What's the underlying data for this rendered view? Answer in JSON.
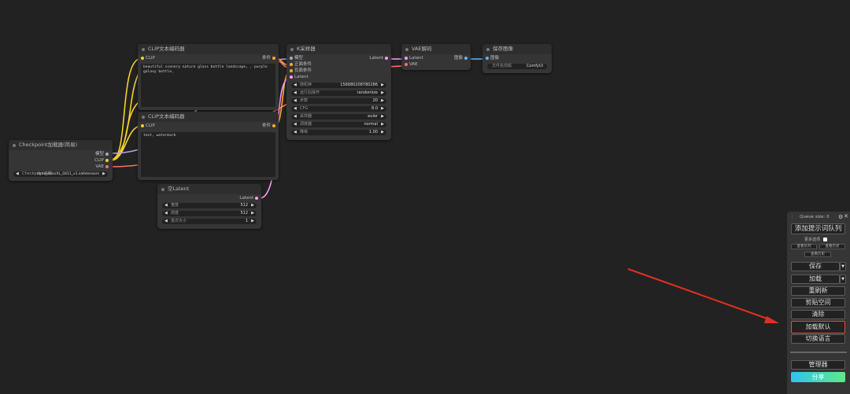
{
  "nodes": {
    "checkpoint": {
      "title": "Checkpoint加载器(简易)",
      "outputs": [
        "模型",
        "CLIP",
        "VAE"
      ],
      "ckpt_label": "Checkpoint名称",
      "ckpt_value": "dynavisionXL_0411_v1.safetensors"
    },
    "clip_pos": {
      "title": "CLIP文本编码器",
      "input": "CLIP",
      "output": "条件",
      "text": "beautiful scenery nature glass bottle landscape, , purple galaxy bottle,"
    },
    "clip_neg": {
      "title": "CLIP文本编码器",
      "input": "CLIP",
      "output": "条件",
      "text": "text, watermark"
    },
    "empty_latent": {
      "title": "空Latent",
      "output": "Latent",
      "widgets": [
        {
          "label": "宽度",
          "value": "512"
        },
        {
          "label": "高度",
          "value": "512"
        },
        {
          "label": "批次大小",
          "value": "1"
        }
      ]
    },
    "ksampler": {
      "title": "K采样器",
      "inputs": [
        "模型",
        "正面条件",
        "负面条件",
        "Latent"
      ],
      "output": "Latent",
      "widgets": [
        {
          "label": "随机种",
          "value": "156680208780286"
        },
        {
          "label": "运行后操作",
          "value": "randomize"
        },
        {
          "label": "步数",
          "value": "20"
        },
        {
          "label": "CFG",
          "value": "8.0"
        },
        {
          "label": "采样器",
          "value": "euler"
        },
        {
          "label": "调度器",
          "value": "normal"
        },
        {
          "label": "降噪",
          "value": "1.00"
        }
      ]
    },
    "vae_decode": {
      "title": "VAE解码",
      "inputs": [
        "Latent",
        "VAE"
      ],
      "output": "图像"
    },
    "save_image": {
      "title": "保存图像",
      "input": "图像",
      "widget_label": "文件名前缀",
      "widget_value": "ComfyUI"
    }
  },
  "menu": {
    "queue_label": "Queue size: 0",
    "settings_icon": "gear-icon",
    "close_icon": "close-icon",
    "queue_button": "添加提示词队列",
    "extra_options": "更多选项",
    "view_queue": "查看队列",
    "view_history": "查看历史",
    "history": "查看历史",
    "save": "保存",
    "load": "加载",
    "refresh": "重刷新",
    "clipspace": "剪贴空间",
    "clear": "清除",
    "load_default": "加载默认",
    "switch_lang": "切换语言",
    "manager": "管理器",
    "share": "分享"
  },
  "colors": {
    "background": "#222222",
    "node": "#353535",
    "clip_wire": "#f7d02c",
    "model_wire": "#b39ddb",
    "vae_wire": "#ff6e6e",
    "cond_wire": "#ffa931",
    "latent_wire": "#ff9cf9",
    "image_wire": "#64b5f6",
    "highlight": "#e74c3c",
    "share_gradient_a": "#2ec4f0",
    "share_gradient_b": "#5ee88a"
  }
}
